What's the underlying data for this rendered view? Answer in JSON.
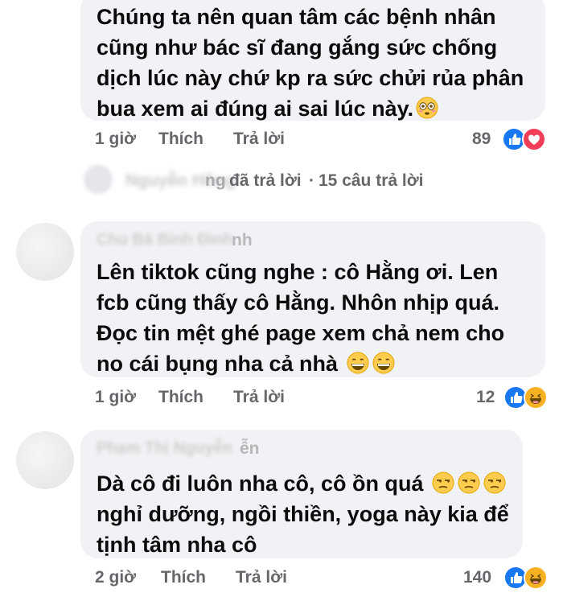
{
  "comments": [
    {
      "text": "Chúng ta nên quan tâm các bệnh nhân\ncũng như bác sĩ đang gắng sức chống\ndịch lúc này chứ kp ra sức chửi rủa phân\nbua xem ai đúng ai sai lúc này.",
      "emojis": [
        "flushed-face"
      ],
      "time": "1 giờ",
      "like_label": "Thích",
      "reply_label": "Trả lời",
      "reaction_count": "89",
      "reactions": [
        "like",
        "love"
      ]
    },
    {
      "author_partial": "nh",
      "text": "Lên tiktok cũng nghe : cô Hằng ơi. Len\nfcb cũng thấy cô Hằng. Nhôn nhịp quá.\nĐọc tin mệt ghé page xem chả nem cho\nno cái bụng nha cả nhà",
      "emojis": [
        "grinning-face",
        "grinning-face"
      ],
      "time": "1 giờ",
      "like_label": "Thích",
      "reply_label": "Trả lời",
      "reaction_count": "12",
      "reactions": [
        "like",
        "haha"
      ]
    },
    {
      "author_partial": "ễn",
      "text": "Dà cô đi luôn nha cô, cô ồn quá",
      "text_rest": "nghỉ dưỡng, ngồi thiền, yoga này kia để\ntịnh tâm nha cô",
      "emojis": [
        "unamused-face",
        "unamused-face",
        "unamused-face"
      ],
      "time": "2 giờ",
      "like_label": "Thích",
      "reply_label": "Trả lời",
      "reaction_count": "140",
      "reactions": [
        "like",
        "haha"
      ]
    }
  ],
  "replies": {
    "name_partial": "ng",
    "replied_label": "đã trả lời",
    "separator": "·",
    "count_label": "15 câu trả lời"
  },
  "colors": {
    "bubble": "#f0f2f5",
    "muted": "#65676b",
    "like_blue": "#1877f2",
    "love_red": "#f33e58",
    "haha_yellow": "#f7b125"
  }
}
